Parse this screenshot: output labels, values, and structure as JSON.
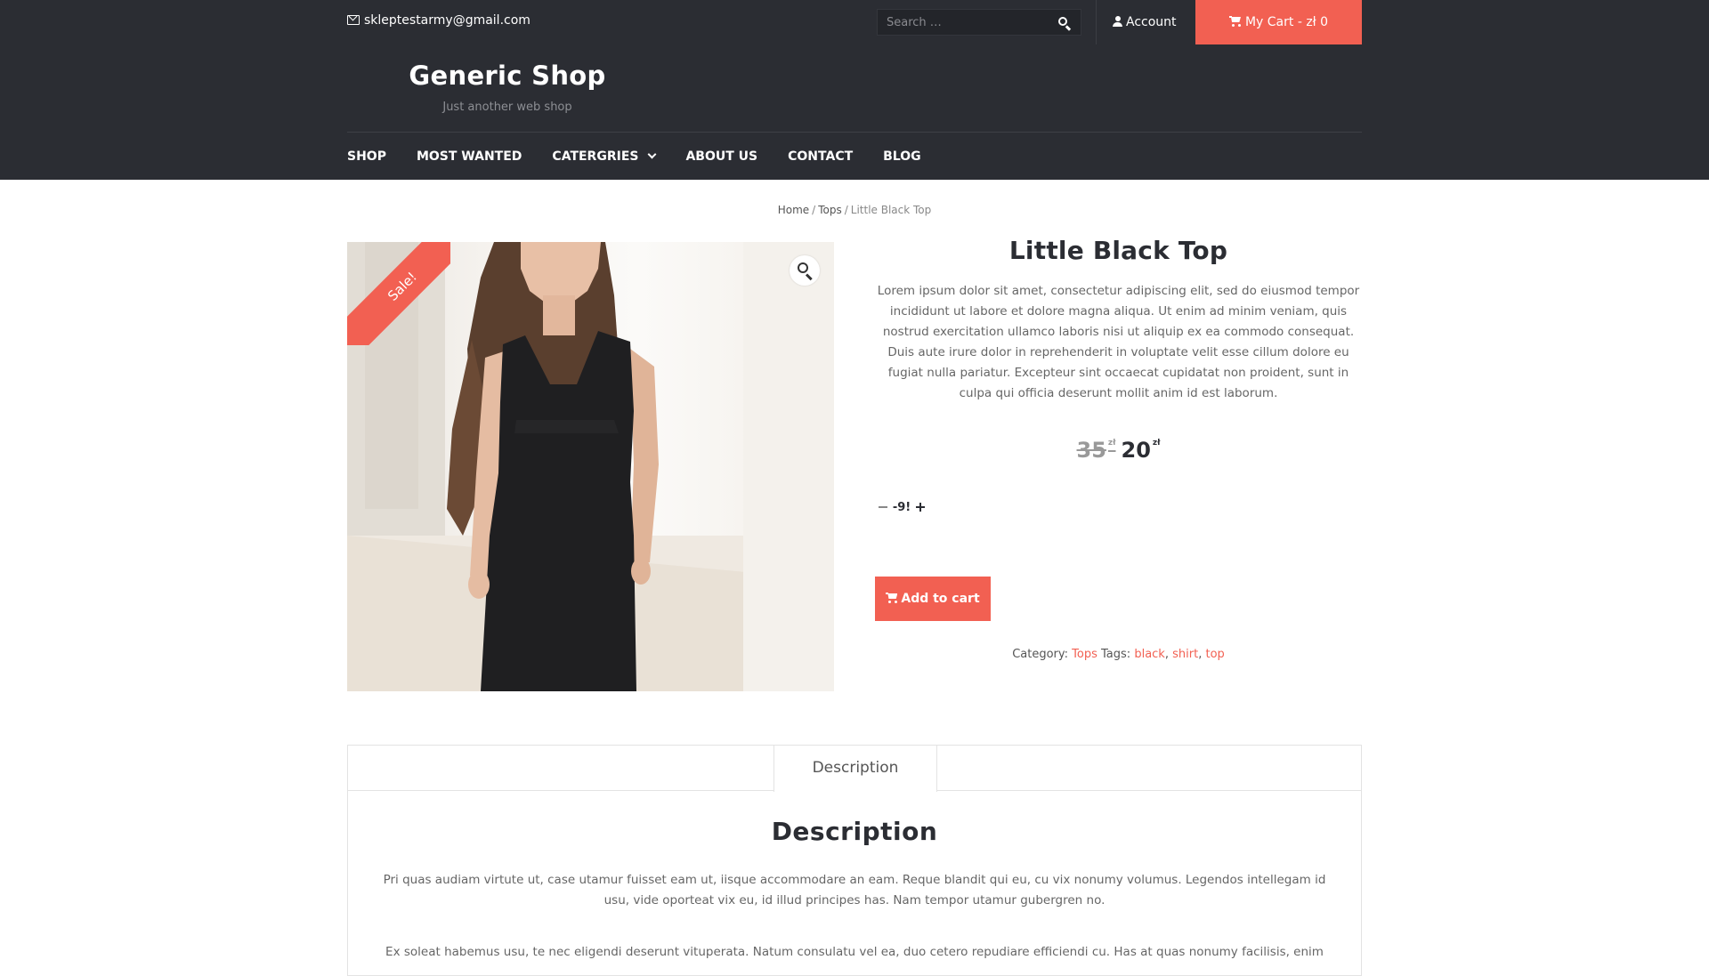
{
  "topbar": {
    "email": "skleptestarmy@gmail.com",
    "search_placeholder": "Search …",
    "account_label": "Account",
    "cart_label": "My Cart - zł 0"
  },
  "header": {
    "site_title": "Generic Shop",
    "tagline": "Just another web shop"
  },
  "nav": {
    "items": [
      {
        "label": "SHOP"
      },
      {
        "label": "MOST WANTED"
      },
      {
        "label": "CATERGRIES"
      },
      {
        "label": "ABOUT US"
      },
      {
        "label": "CONTACT"
      },
      {
        "label": "BLOG"
      }
    ]
  },
  "breadcrumb": {
    "home": "Home",
    "category": "Tops",
    "current": "Little Black Top",
    "separator": "/"
  },
  "product": {
    "sale_badge": "Sale!",
    "title": "Little Black Top",
    "short_description": "Lorem ipsum dolor sit amet, consectetur adipiscing elit, sed do eiusmod tempor incididunt ut labore et dolore magna aliqua. Ut enim ad minim veniam, quis nostrud exercitation ullamco laboris nisi ut aliquip ex ea commodo consequat. Duis aute irure dolor in reprehenderit in voluptate velit esse cillum dolore eu fugiat nulla pariatur. Excepteur sint occaecat cupidatat non proident, sunt in culpa qui officia deserunt mollit anim id est laborum.",
    "old_price": "35",
    "new_price": "20",
    "currency": "zł",
    "quantity": "-9!",
    "add_to_cart": "Add to cart",
    "category_label": "Category:",
    "category": "Tops",
    "tags_label": "Tags:",
    "tags": [
      "black",
      "shirt",
      "top"
    ],
    "tag_sep": ","
  },
  "tabs": {
    "active": "Description",
    "content_title": "Description",
    "paragraph_1": "Pri quas audiam virtute ut, case utamur fuisset eam ut, iisque accommodare an eam. Reque blandit qui eu, cu vix nonumy volumus. Legendos intellegam id usu, vide oporteat vix eu, id illud principes has. Nam tempor utamur gubergren no.",
    "paragraph_2": "Ex soleat habemus usu, te nec eligendi deserunt vituperata. Natum consulatu vel ea, duo cetero repudiare efficiendi cu. Has at quas nonumy facilisis, enim"
  },
  "colors": {
    "accent": "#f26052",
    "dark": "#2b2d33"
  }
}
